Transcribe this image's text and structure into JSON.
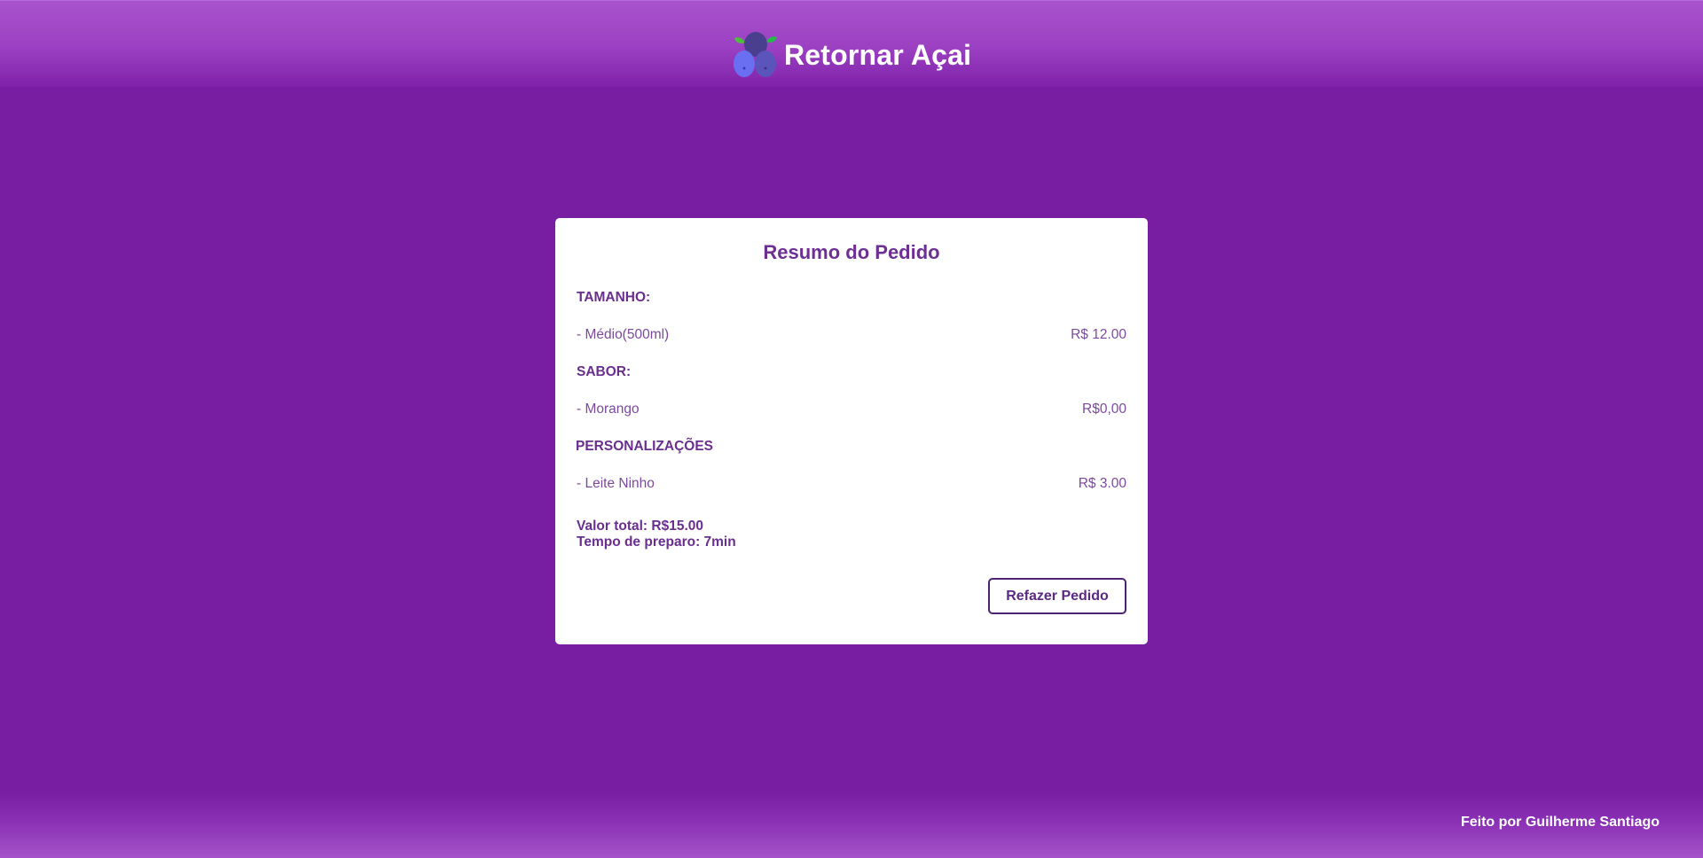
{
  "header": {
    "brand_title": "Retornar Açai",
    "logo_icon": "acai-berries-icon"
  },
  "order_summary": {
    "title": "Resumo do Pedido",
    "size_label": "TAMANHO:",
    "size_item": {
      "name": "- Médio(500ml)",
      "price": "R$ 12.00"
    },
    "flavor_label": "SABOR:",
    "flavor_item": {
      "name": "- Morango",
      "price": "R$0,00"
    },
    "custom_label": "PERSONALIZAÇÕES",
    "custom_item": {
      "name": "- Leite Ninho",
      "price": "R$ 3.00"
    },
    "total": "Valor total: R$15.00",
    "prep_time": "Tempo de preparo: 7min",
    "redo_button": "Refazer Pedido"
  },
  "footer": {
    "credit": "Feito por Guilherme Santiago"
  },
  "colors": {
    "background": "#781ea2",
    "header_top": "#a953cd",
    "card_text": "#6e2f93",
    "card_bg": "#ffffff"
  }
}
